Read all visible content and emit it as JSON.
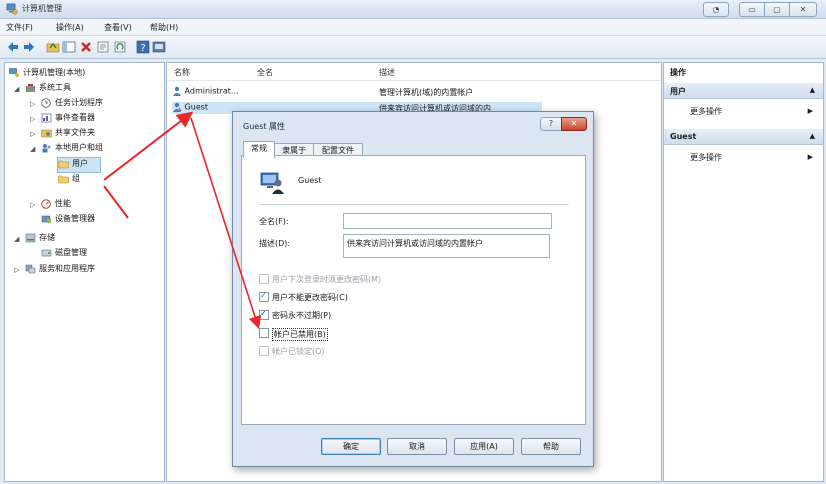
{
  "window": {
    "title": "计算机管理",
    "buttons": [
      "◔",
      "▭",
      "▢",
      "✕"
    ]
  },
  "menu": [
    "文件(F)",
    "操作(A)",
    "查看(V)",
    "帮助(H)"
  ],
  "tree": {
    "items": [
      {
        "label": "计算机管理(本地)",
        "icon": "computer-management-icon"
      },
      {
        "label": "系统工具",
        "icon": "tools-icon"
      },
      {
        "label": "任务计划程序",
        "icon": "clock-icon"
      },
      {
        "label": "事件查看器",
        "icon": "event-viewer-icon"
      },
      {
        "label": "共享文件夹",
        "icon": "shared-folder-icon"
      },
      {
        "label": "本地用户和组",
        "icon": "users-group-icon"
      },
      {
        "label": "用户",
        "icon": "folder-icon"
      },
      {
        "label": "组",
        "icon": "folder-icon"
      },
      {
        "label": "性能",
        "icon": "performance-icon"
      },
      {
        "label": "设备管理器",
        "icon": "device-manager-icon"
      },
      {
        "label": "存储",
        "icon": "storage-icon"
      },
      {
        "label": "磁盘管理",
        "icon": "disk-icon"
      },
      {
        "label": "服务和应用程序",
        "icon": "services-icon"
      }
    ]
  },
  "list": {
    "columns": [
      "名称",
      "全名",
      "描述"
    ],
    "rows": [
      {
        "name": "Administrat...",
        "fullname": "",
        "desc": "管理计算机(域)的内置帐户"
      },
      {
        "name": "Guest",
        "fullname": "",
        "desc": "供来宾访问计算机或访问域的内"
      }
    ]
  },
  "actions": {
    "title": "操作",
    "sections": [
      {
        "header": "用户",
        "item": "更多操作"
      },
      {
        "header": "Guest",
        "item": "更多操作"
      }
    ]
  },
  "dialog": {
    "title": "Guest 属性",
    "help": "?",
    "close": "✕",
    "tabs": [
      "常规",
      "隶属于",
      "配置文件"
    ],
    "username": "Guest",
    "fullname_label": "全名(F):",
    "fullname_value": "",
    "desc_label": "描述(D):",
    "desc_value": "供来宾访问计算机或访问域的内置帐户",
    "checkboxes": [
      {
        "label": "用户下次登录时须更改密码(M)",
        "checked": false,
        "disabled": true
      },
      {
        "label": "用户不能更改密码(C)",
        "checked": true,
        "disabled": false
      },
      {
        "label": "密码永不过期(P)",
        "checked": true,
        "disabled": false
      },
      {
        "label": "帐户已禁用(B)",
        "checked": false,
        "disabled": false
      },
      {
        "label": "帐户已锁定(O)",
        "checked": false,
        "disabled": true
      }
    ],
    "buttons": [
      "确定",
      "取消",
      "应用(A)",
      "帮助"
    ]
  },
  "colors": {
    "annotation": "#e8262b",
    "accent": "#3c7fb1"
  }
}
